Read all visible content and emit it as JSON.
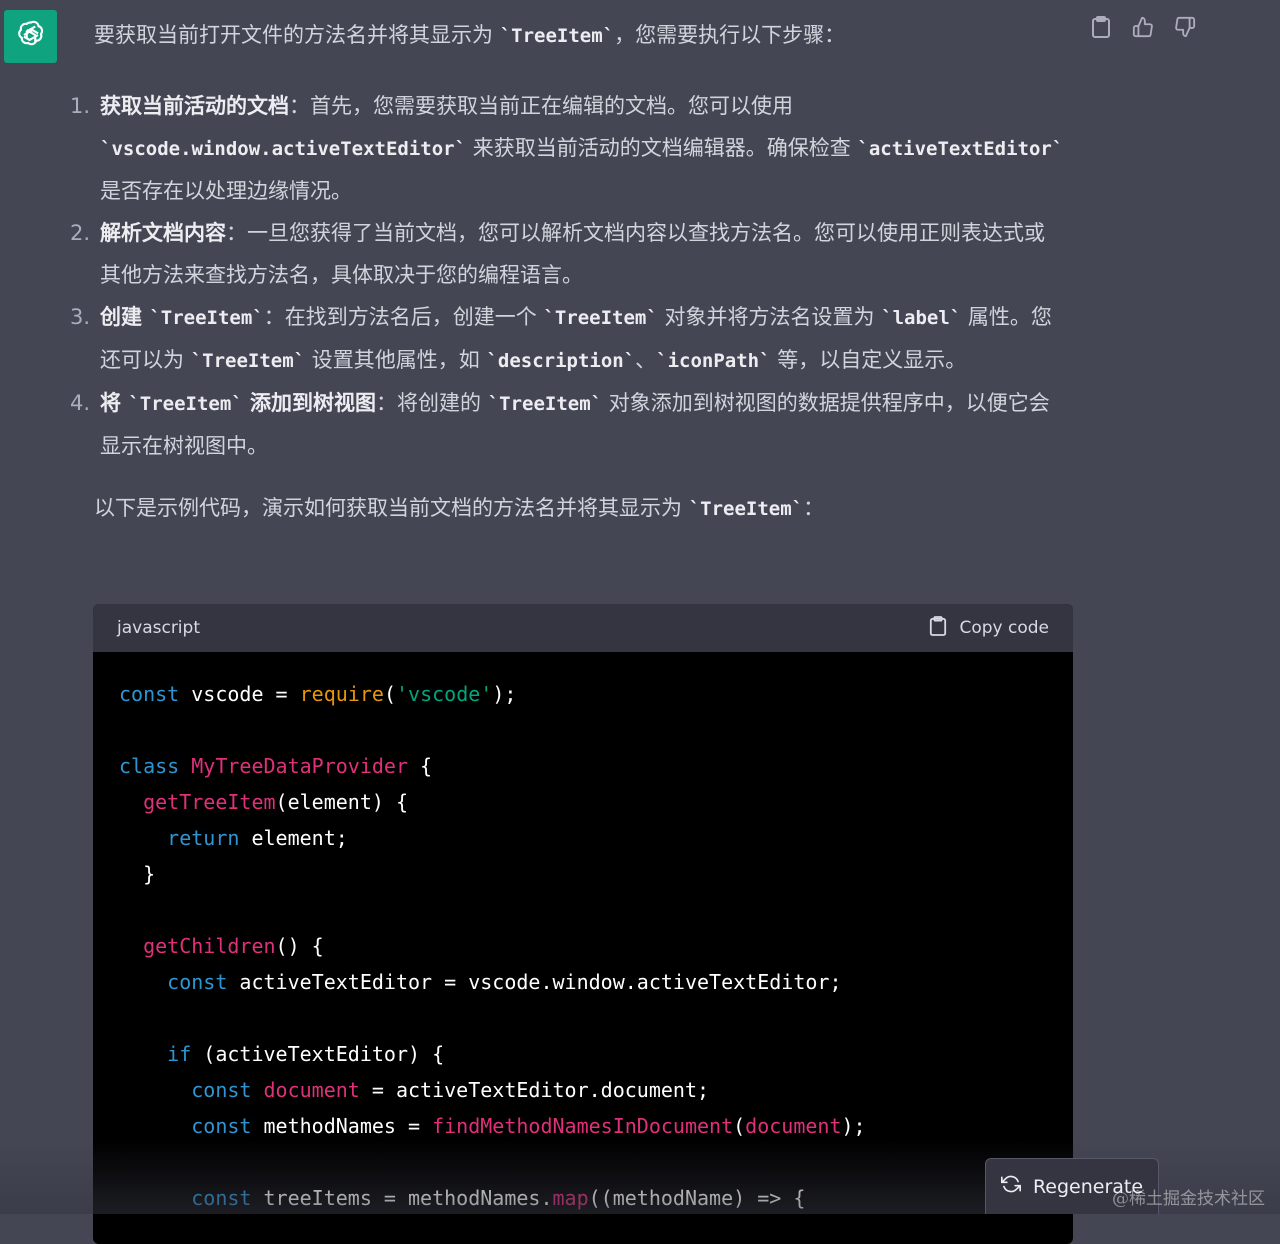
{
  "message": {
    "intro": {
      "text1": "要获取当前打开文件的方法名并将其显示为 ",
      "code1": "`TreeItem`",
      "text2": "，您需要执行以下步骤："
    },
    "steps": [
      {
        "number": "1.",
        "title": "获取当前活动的文档",
        "t1": "：首先，您需要获取当前正在编辑的文档。您可以使用 ",
        "c1": "`vscode.window.activeTextEditor`",
        "t2": " 来获取当前活动的文档编辑器。确保检查 ",
        "c2": "`activeTextEditor`",
        "t3": " 是否存在以处理边缘情况。"
      },
      {
        "number": "2.",
        "title": "解析文档内容",
        "t1": "：一旦您获得了当前文档，您可以解析文档内容以查找方法名。您可以使用正则表达式或其他方法来查找方法名，具体取决于您的编程语言。"
      },
      {
        "number": "3.",
        "title_pre": "创建 ",
        "title_code": "`TreeItem`",
        "t1": "：在找到方法名后，创建一个 ",
        "c1": "`TreeItem`",
        "t2": " 对象并将方法名设置为 ",
        "c2": "`label`",
        "t3": " 属性。您还可以为 ",
        "c3": "`TreeItem`",
        "t4": " 设置其他属性，如 ",
        "c4": "`description`",
        "t5": "、",
        "c5": "`iconPath`",
        "t6": " 等，以自定义显示。"
      },
      {
        "number": "4.",
        "title_pre": "将 ",
        "title_code": "`TreeItem`",
        "title_post": " 添加到树视图",
        "t1": "：将创建的 ",
        "c1": "`TreeItem`",
        "t2": " 对象添加到树视图的数据提供程序中，以便它会显示在树视图中。"
      }
    ],
    "outro": {
      "text1": "以下是示例代码，演示如何获取当前文档的方法名并将其显示为 ",
      "code1": "`TreeItem`",
      "text2": "："
    }
  },
  "code_block": {
    "language": "javascript",
    "copy_label": "Copy code",
    "lines": [
      [
        {
          "t": "const",
          "c": "k"
        },
        {
          "t": " vscode = "
        },
        {
          "t": "require",
          "c": "o"
        },
        {
          "t": "("
        },
        {
          "t": "'vscode'",
          "c": "s"
        },
        {
          "t": ");"
        }
      ],
      [],
      [
        {
          "t": "class",
          "c": "k"
        },
        {
          "t": " "
        },
        {
          "t": "MyTreeDataProvider",
          "c": "f"
        },
        {
          "t": " {"
        }
      ],
      [
        {
          "t": "  "
        },
        {
          "t": "getTreeItem",
          "c": "f"
        },
        {
          "t": "(element) {"
        }
      ],
      [
        {
          "t": "    "
        },
        {
          "t": "return",
          "c": "k"
        },
        {
          "t": " element;"
        }
      ],
      [
        {
          "t": "  }"
        }
      ],
      [],
      [
        {
          "t": "  "
        },
        {
          "t": "getChildren",
          "c": "f"
        },
        {
          "t": "() {"
        }
      ],
      [
        {
          "t": "    "
        },
        {
          "t": "const",
          "c": "k"
        },
        {
          "t": " activeTextEditor = vscode.window.activeTextEditor;"
        }
      ],
      [],
      [
        {
          "t": "    "
        },
        {
          "t": "if",
          "c": "k"
        },
        {
          "t": " (activeTextEditor) {"
        }
      ],
      [
        {
          "t": "      "
        },
        {
          "t": "const",
          "c": "k"
        },
        {
          "t": " "
        },
        {
          "t": "document",
          "c": "f"
        },
        {
          "t": " = activeTextEditor.document;"
        }
      ],
      [
        {
          "t": "      "
        },
        {
          "t": "const",
          "c": "k"
        },
        {
          "t": " methodNames = "
        },
        {
          "t": "findMethodNamesInDocument",
          "c": "f"
        },
        {
          "t": "("
        },
        {
          "t": "document",
          "c": "f"
        },
        {
          "t": ");"
        }
      ],
      [],
      [
        {
          "t": "      "
        },
        {
          "t": "const",
          "c": "k"
        },
        {
          "t": " treeItems = methodNames."
        },
        {
          "t": "map",
          "c": "f"
        },
        {
          "t": "((methodName) => {"
        }
      ]
    ]
  },
  "regenerate_label": "Regenerate",
  "watermark": "@稀土掘金技术社区",
  "icons": {
    "avatar": "openai-logo-icon",
    "copy": "clipboard-icon",
    "like": "thumbs-up-icon",
    "dislike": "thumbs-down-icon",
    "regenerate": "refresh-icon"
  },
  "colors": {
    "background": "#444654",
    "avatar_bg": "#10a37f",
    "code_bg": "#000000",
    "code_header_bg": "#343541",
    "keyword": "#2e95d3",
    "function": "#df3079",
    "string": "#00a67d",
    "builtin": "#e9950c"
  }
}
